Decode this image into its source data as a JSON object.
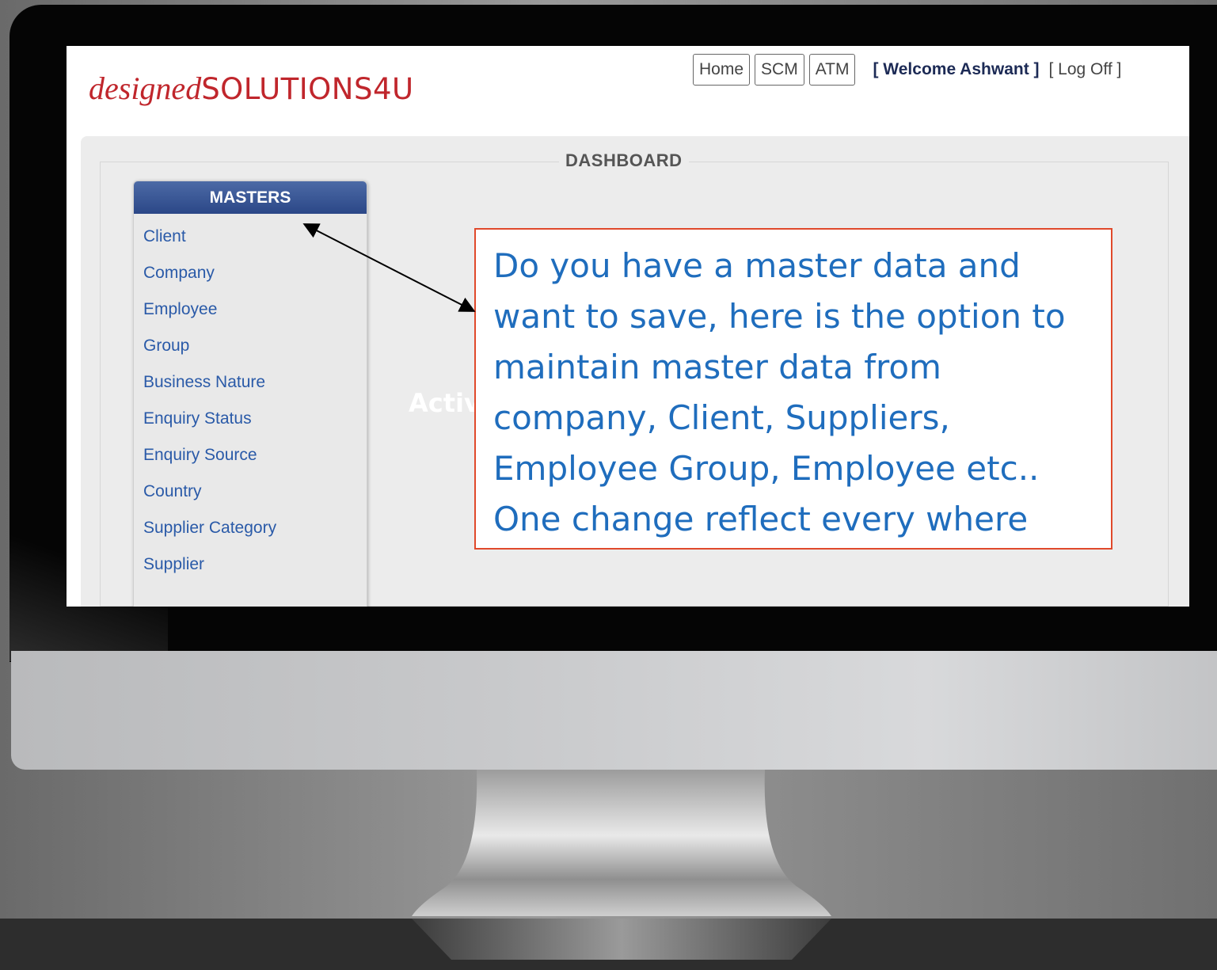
{
  "logo": {
    "part1": "designed",
    "part2": "SOLUTIONS4U"
  },
  "nav": {
    "buttons": [
      "Home",
      "SCM",
      "ATM"
    ],
    "welcome": "[ Welcome Ashwant ]",
    "logoff": "[ Log Off ]"
  },
  "dashboard": {
    "title": "DASHBOARD"
  },
  "masters": {
    "header": "MASTERS",
    "items": [
      "Client",
      "Company",
      "Employee",
      "Group",
      "Business Nature",
      "Enquiry Status",
      "Enquiry Source",
      "Country",
      "Supplier Category",
      "Supplier"
    ]
  },
  "overlay_text": "Activ",
  "callout": {
    "lines": [
      "Do you have a master data and",
      "want to save, here is the option to",
      "maintain master data from",
      "company, Client, Suppliers,",
      "Employee Group, Employee etc..",
      "One change reflect every where"
    ]
  },
  "colors": {
    "brand": "#c0262c",
    "masters_header": "#2b4787",
    "link": "#2a5aa8",
    "callout_border": "#e0492b",
    "callout_text": "#1f6dbd"
  }
}
